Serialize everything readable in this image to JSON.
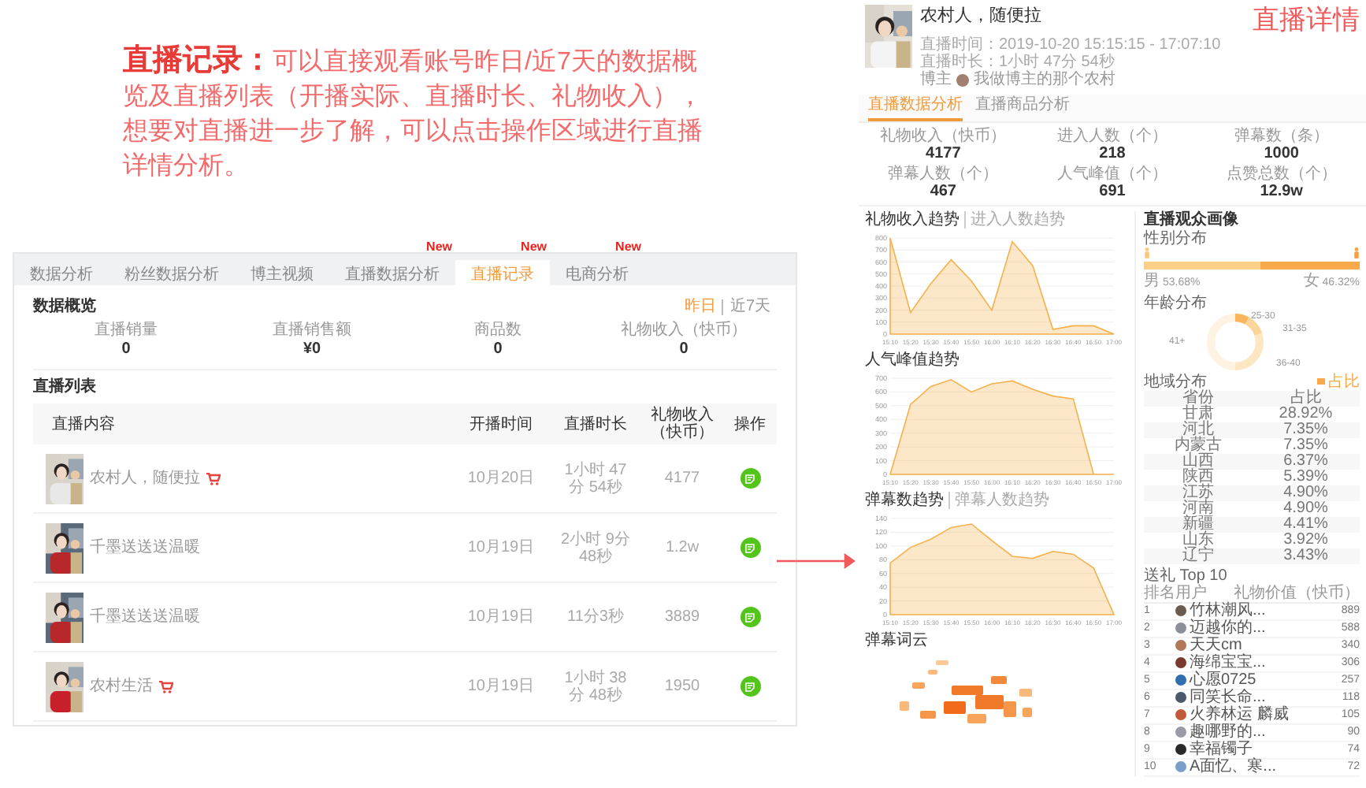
{
  "annotation": {
    "text": "**直播记录：**可以直接观看账号昨日/近7天的数据概览及直播列表（开播实际、直播时长、礼物收入），想要对直播进一步了解，可以点击操作区域进行直播详情分析。"
  },
  "records_panel": {
    "tabs": [
      {
        "label": "数据分析",
        "selected": false
      },
      {
        "label": "粉丝数据分析",
        "selected": false
      },
      {
        "label": "博主视频",
        "selected": false
      },
      {
        "label": "直播数据分析",
        "selected": false,
        "badge": "New"
      },
      {
        "label": "直播记录",
        "selected": true,
        "badge": "New"
      },
      {
        "label": "电商分析",
        "selected": false,
        "badge": "New"
      }
    ],
    "overview": {
      "title": "数据概览",
      "periods": [
        {
          "label": "昨日",
          "selected": true
        },
        {
          "label": "近7天",
          "selected": false
        }
      ],
      "stats": [
        {
          "label": "直播销量",
          "value": "0"
        },
        {
          "label": "直播销售额",
          "value": "¥0"
        },
        {
          "label": "商品数",
          "value": "0"
        },
        {
          "label": "礼物收入（快币）",
          "value": "0"
        }
      ]
    },
    "list": {
      "title": "直播列表",
      "columns": [
        "直播内容",
        "开播时间",
        "直播时长",
        "礼物收入（快币）",
        "操作"
      ],
      "rows": [
        {
          "title": "农村人，随便拉",
          "shop": true,
          "date": "10月20日",
          "duration": "1小时 47分 54秒",
          "gift_income": "4177"
        },
        {
          "title": "千墨送送送温暖",
          "shop": false,
          "date": "10月19日",
          "duration": "2小时 9分 48秒",
          "gift_income": "1.2w"
        },
        {
          "title": "千墨送送送温暖",
          "shop": false,
          "date": "10月19日",
          "duration": "11分3秒",
          "gift_income": "3889"
        },
        {
          "title": "农村生活",
          "shop": true,
          "date": "10月19日",
          "duration": "1小时 38分 48秒",
          "gift_income": "1950"
        }
      ]
    }
  },
  "detail_panel": {
    "label": "直播详情",
    "streamer": {
      "name": "农村人，随便拉",
      "time": "直播时间：2019-10-20 15:15:15 - 17:07:10",
      "duration": "直播时长：1小时 47分 54秒",
      "host_label": "博主",
      "host_name": "我做博主的那个农村"
    },
    "tabs": [
      {
        "label": "直播数据分析",
        "selected": true
      },
      {
        "label": "直播商品分析",
        "selected": false
      }
    ],
    "stats": [
      {
        "label": "礼物收入（快币）",
        "value": "4177"
      },
      {
        "label": "进入人数（个）",
        "value": "218"
      },
      {
        "label": "弹幕数（条）",
        "value": "1000"
      },
      {
        "label": "弹幕人数（个）",
        "value": "467"
      },
      {
        "label": "人气峰值（个）",
        "value": "691"
      },
      {
        "label": "点赞总数（个）",
        "value": "12.9w"
      }
    ],
    "charts": [
      {
        "titles": [
          {
            "label": "礼物收入趋势",
            "selected": true
          },
          {
            "label": "进入人数趋势",
            "selected": false
          }
        ],
        "chart_data": {
          "type": "area",
          "categories": [
            "15:10",
            "15:20",
            "15:30",
            "15:40",
            "15:50",
            "16:00",
            "16:10",
            "16:20",
            "16:30",
            "16:40",
            "16:50",
            "17:00"
          ],
          "ylim": [
            0,
            800
          ],
          "yticks": [
            0,
            100,
            200,
            300,
            400,
            500,
            600,
            700,
            800
          ],
          "grid": true,
          "series": [
            {
              "color": "#f5b14c",
              "values": [
                800,
                180,
                420,
                620,
                440,
                200,
                770,
                570,
                40,
                70,
                70,
                0
              ]
            }
          ]
        }
      },
      {
        "titles": [
          {
            "label": "人气峰值趋势",
            "selected": true
          }
        ],
        "chart_data": {
          "type": "area",
          "categories": [
            "15:10",
            "15:20",
            "15:30",
            "15:40",
            "15:50",
            "16:00",
            "16:10",
            "16:20",
            "16:30",
            "16:40",
            "16:50",
            "17:00"
          ],
          "ylim": [
            0,
            700
          ],
          "yticks": [
            0,
            100,
            200,
            300,
            400,
            500,
            600,
            700
          ],
          "grid": true,
          "series": [
            {
              "color": "#f5b14c",
              "values": [
                0,
                510,
                640,
                690,
                600,
                660,
                680,
                620,
                570,
                550,
                0,
                0
              ]
            }
          ]
        }
      },
      {
        "titles": [
          {
            "label": "弹幕数趋势",
            "selected": true
          },
          {
            "label": "弹幕人数趋势",
            "selected": false
          }
        ],
        "chart_data": {
          "type": "area",
          "categories": [
            "15:10",
            "15:20",
            "15:30",
            "15:40",
            "15:50",
            "16:00",
            "16:10",
            "16:20",
            "16:30",
            "16:40",
            "16:50",
            "17:00"
          ],
          "ylim": [
            0,
            140
          ],
          "yticks": [
            0,
            20,
            40,
            60,
            80,
            100,
            120,
            140
          ],
          "grid": true,
          "series": [
            {
              "color": "#f5b14c",
              "values": [
                75,
                98,
                110,
                127,
                132,
                108,
                85,
                82,
                92,
                88,
                68,
                0
              ]
            }
          ]
        }
      }
    ],
    "word_cloud": {
      "title": "弹幕词云"
    },
    "audience": {
      "title": "直播观众画像",
      "gender": {
        "title": "性别分布",
        "male": {
          "label": "男",
          "value": "53.68%",
          "level": 0.5368
        },
        "female": {
          "label": "女",
          "value": "46.32%"
        }
      },
      "age": {
        "title": "年龄分布",
        "labels": [
          "25-30",
          "31-35",
          "36-40",
          "41+"
        ]
      },
      "region": {
        "title": "地域分布",
        "legend": "占比",
        "columns": [
          "省份",
          "占比"
        ],
        "rows": [
          [
            "甘肃",
            "28.92%"
          ],
          [
            "河北",
            "7.35%"
          ],
          [
            "内蒙古",
            "7.35%"
          ],
          [
            "山西",
            "6.37%"
          ],
          [
            "陕西",
            "5.39%"
          ],
          [
            "江苏",
            "4.90%"
          ],
          [
            "河南",
            "4.90%"
          ],
          [
            "新疆",
            "4.41%"
          ],
          [
            "山东",
            "3.92%"
          ],
          [
            "辽宁",
            "3.43%"
          ]
        ]
      },
      "gifts": {
        "title": "送礼 Top 10",
        "columns": [
          "排名",
          "用户",
          "礼物价值（快币）"
        ],
        "rows": [
          {
            "rank": "1",
            "name": "竹林潮风...",
            "value": "889",
            "color": "#6b5b4e"
          },
          {
            "rank": "2",
            "name": "迈越你的...",
            "value": "588",
            "color": "#8a8f99"
          },
          {
            "rank": "3",
            "name": "天天cm",
            "value": "340",
            "color": "#b07a5a"
          },
          {
            "rank": "4",
            "name": "海绵宝宝...",
            "value": "306",
            "color": "#7a3b2e"
          },
          {
            "rank": "5",
            "name": "心愿0725",
            "value": "257",
            "color": "#2f6fb0"
          },
          {
            "rank": "6",
            "name": "同笑长命...",
            "value": "118",
            "color": "#4a5a6a"
          },
          {
            "rank": "7",
            "name": "火养林运 麟威",
            "value": "105",
            "color": "#c05a3a"
          },
          {
            "rank": "8",
            "name": "趣哪野的...",
            "value": "90",
            "color": "#9a9aa8"
          },
          {
            "rank": "9",
            "name": "幸福镯子",
            "value": "74",
            "color": "#2a2a2a"
          },
          {
            "rank": "10",
            "name": "A面忆、寒...",
            "value": "72",
            "color": "#7aa0c8"
          }
        ]
      }
    }
  }
}
